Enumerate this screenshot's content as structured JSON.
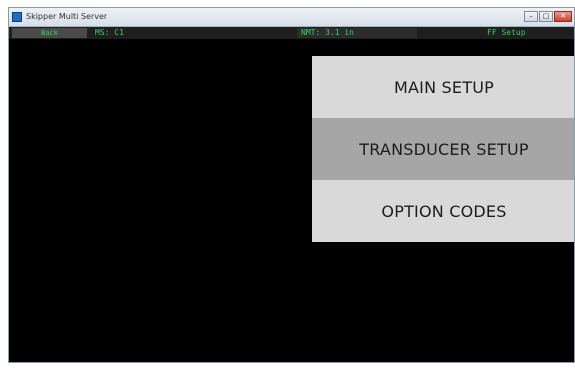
{
  "window": {
    "title": "Skipper Multi Server",
    "buttons": {
      "minimize": "–",
      "maximize": "□",
      "close": "✕"
    }
  },
  "statusbar": {
    "back_label": "Back",
    "left_value": "MS: C1",
    "mid_value": "NMT: 3.1 in",
    "right_value": "FF Setup"
  },
  "menu": {
    "items": [
      {
        "label": "MAIN SETUP"
      },
      {
        "label": "TRANSDUCER SETUP"
      },
      {
        "label": "OPTION CODES"
      }
    ]
  },
  "colors": {
    "background": "#000000",
    "status_text": "#2fd35a",
    "menu_item": "#d9d9d9",
    "menu_item_selected": "#a6a6a6"
  }
}
